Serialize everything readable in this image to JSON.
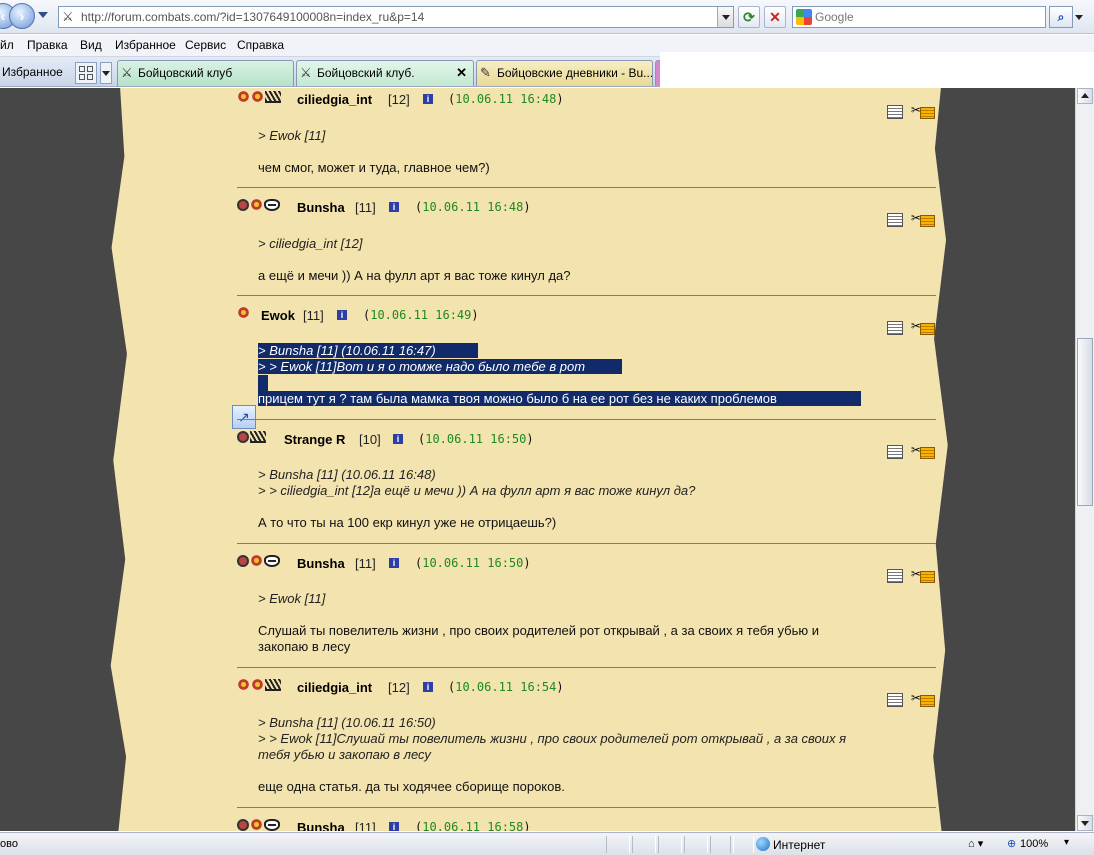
{
  "browser": {
    "url": "http://forum.combats.com/?id=1307649100008n=index_ru&p=14",
    "search_placeholder": "Google",
    "menu": [
      "йл",
      "Правка",
      "Вид",
      "Избранное",
      "Сервис",
      "Справка"
    ],
    "favorites_label": "Избранное",
    "tabs": [
      {
        "title": "Бойцовский клуб",
        "active": false
      },
      {
        "title": "Бойцовский клуб.",
        "active": true
      },
      {
        "title": "Бойцовские дневники - Bu...",
        "active": false
      }
    ],
    "status_text": "ово",
    "zone_text": "Интернет",
    "zoom": "100%"
  },
  "posts": [
    {
      "nick": "ciliedgia_int",
      "level": "[12]",
      "date": "10.06.11 16:48",
      "icons": [
        "round",
        "flower",
        "spike"
      ],
      "quote": [
        "> Ewok [11]"
      ],
      "body": "чем смог, может и туда, главное чем?)"
    },
    {
      "nick": "Bunsha",
      "level": "[11]",
      "date": "10.06.11 16:48",
      "icons": [
        "round",
        "flower",
        "mask"
      ],
      "quote": [
        "> ciliedgia_int [12]"
      ],
      "body": "а ещё и мечи )) А на фулл арт я вас тоже кинул да?"
    },
    {
      "nick": "Ewok",
      "level": "[11]",
      "date": "10.06.11 16:49",
      "icons": [
        "flower"
      ],
      "quote": [
        ">  Bunsha [11] (10.06.11 16:47)",
        "> > Ewok [11]Вот и я о томже надо было тебе в рот"
      ],
      "body": "прицем тут я ? там была мамка твоя можно было б на ее рот без не каких проблемов"
    },
    {
      "nick": "Strange R",
      "level": "[10]",
      "date": "10.06.11 16:50",
      "icons": [
        "round",
        "spike"
      ],
      "quote": [
        ">  Bunsha [11] (10.06.11 16:48)",
        "> > ciliedgia_int [12]а ещё и мечи )) А на фулл арт я вас тоже кинул да?"
      ],
      "body": "А то что ты на 100 екр кинул уже не отрицаешь?)"
    },
    {
      "nick": "Bunsha",
      "level": "[11]",
      "date": "10.06.11 16:50",
      "icons": [
        "round",
        "flower",
        "mask"
      ],
      "quote": [
        "> Ewok [11]"
      ],
      "body_lines": [
        "Слушай ты повелитель жизни , про своих родителей рот открывай , а за своих я тебя убью и",
        "закопаю в лесу"
      ]
    },
    {
      "nick": "ciliedgia_int",
      "level": "[12]",
      "date": "10.06.11 16:54",
      "icons": [
        "round",
        "flower",
        "spike"
      ],
      "quote": [
        ">  Bunsha [11] (10.06.11 16:50)",
        "> > Ewok [11]Слушай ты повелитель жизни , про своих родителей рот открывай , а за своих я",
        "тебя убью и закопаю в лесу"
      ],
      "body": "еще одна статья. да ты ходячее сборище пороков."
    },
    {
      "nick": "Bunsha",
      "level": "[11]",
      "date": "10.06.11 16:58",
      "icons": [
        "round",
        "flower",
        "mask"
      ]
    }
  ]
}
